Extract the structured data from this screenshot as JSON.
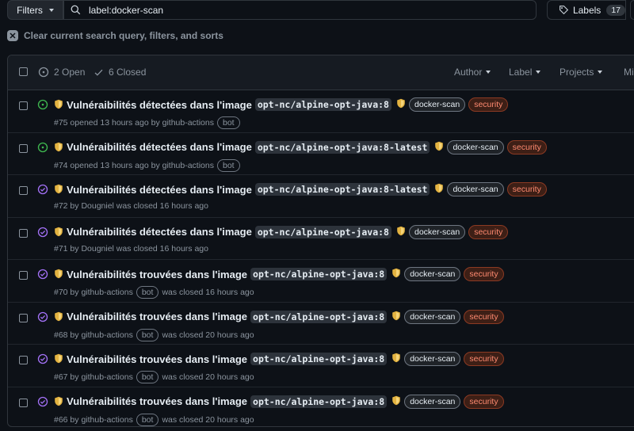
{
  "toolbar": {
    "filters_label": "Filters",
    "search_value": "label:docker-scan",
    "labels_label": "Labels",
    "labels_count": "17"
  },
  "clear_text": "Clear current search query, filters, and sorts",
  "header": {
    "open_label": "2 Open",
    "closed_label": "6 Closed",
    "author_label": "Author",
    "label_label": "Label",
    "projects_label": "Projects",
    "milestones_label": "Mi"
  },
  "issues": [
    {
      "state": "open",
      "title": "Vulnéraibilités détectées dans l'image",
      "code": "opt-nc/alpine-opt-java:8",
      "label1": "docker-scan",
      "label2": "security",
      "meta_a": "#75 opened 13 hours ago by github-actions",
      "bot": "bot",
      "meta_b": ""
    },
    {
      "state": "open",
      "title": "Vulnéraibilités détectées dans l'image",
      "code": "opt-nc/alpine-opt-java:8-latest",
      "label1": "docker-scan",
      "label2": "security",
      "meta_a": "#74 opened 13 hours ago by github-actions",
      "bot": "bot",
      "meta_b": ""
    },
    {
      "state": "closed",
      "title": "Vulnéraibilités détectées dans l'image",
      "code": "opt-nc/alpine-opt-java:8-latest",
      "label1": "docker-scan",
      "label2": "security",
      "meta_a": "#72 by Dougniel was closed 16 hours ago",
      "bot": "",
      "meta_b": ""
    },
    {
      "state": "closed",
      "title": "Vulnéraibilités détectées dans l'image",
      "code": "opt-nc/alpine-opt-java:8",
      "label1": "docker-scan",
      "label2": "security",
      "meta_a": "#71 by Dougniel was closed 16 hours ago",
      "bot": "",
      "meta_b": ""
    },
    {
      "state": "closed",
      "title": "Vulnéraibilités trouvées dans l'image",
      "code": "opt-nc/alpine-opt-java:8",
      "label1": "docker-scan",
      "label2": "security",
      "meta_a": "#70 by github-actions",
      "bot": "bot",
      "meta_b": "was closed 16 hours ago"
    },
    {
      "state": "closed",
      "title": "Vulnéraibilités trouvées dans l'image",
      "code": "opt-nc/alpine-opt-java:8",
      "label1": "docker-scan",
      "label2": "security",
      "meta_a": "#68 by github-actions",
      "bot": "bot",
      "meta_b": "was closed 20 hours ago"
    },
    {
      "state": "closed",
      "title": "Vulnéraibilités trouvées dans l'image",
      "code": "opt-nc/alpine-opt-java:8",
      "label1": "docker-scan",
      "label2": "security",
      "meta_a": "#67 by github-actions",
      "bot": "bot",
      "meta_b": "was closed 20 hours ago"
    },
    {
      "state": "closed",
      "title": "Vulnéraibilités trouvées dans l'image",
      "code": "opt-nc/alpine-opt-java:8",
      "label1": "docker-scan",
      "label2": "security",
      "meta_a": "#66 by github-actions",
      "bot": "bot",
      "meta_b": "was closed 20 hours ago"
    }
  ],
  "colors": {
    "open": "#3fb950",
    "closed": "#a371f7",
    "shield": "#e3b341",
    "security": "#ff8a70"
  },
  "icons": {
    "search": "search-icon",
    "tag": "tag-icon",
    "clear": "x-icon",
    "open_state": "issue-opened-icon",
    "closed_state": "issue-closed-icon",
    "check": "check-icon",
    "shield": "shield-icon"
  }
}
